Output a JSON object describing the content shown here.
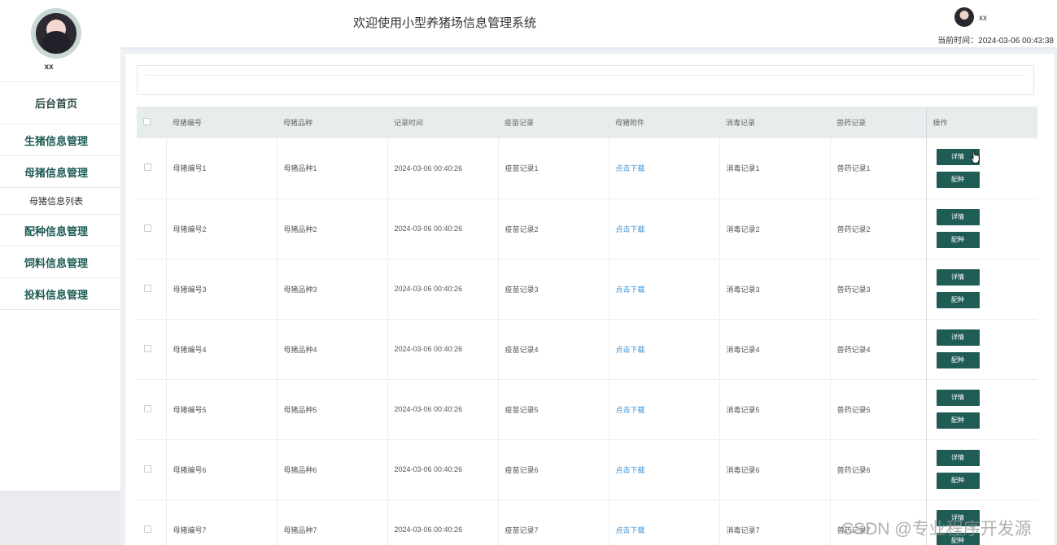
{
  "sidebar": {
    "username": "xx",
    "items": [
      {
        "label": "后台首页"
      },
      {
        "label": "生猪信息管理"
      },
      {
        "label": "母猪信息管理"
      },
      {
        "label": "母猪信息列表"
      },
      {
        "label": "配种信息管理"
      },
      {
        "label": "饲料信息管理"
      },
      {
        "label": "投料信息管理"
      }
    ]
  },
  "header": {
    "title": "欢迎使用小型养猪场信息管理系统",
    "username": "xx",
    "time": "当前时间：2024-03-06 00:43:38"
  },
  "table": {
    "headers": [
      "母猪编号",
      "母猪品种",
      "记录时间",
      "疫苗记录",
      "母猪附件",
      "消毒记录",
      "兽药记录",
      "操作"
    ],
    "rows": [
      {
        "no": "母猪编号1",
        "breed": "母猪品种1",
        "time": "2024-03-06 00:40:26",
        "vaccine": "疫苗记录1",
        "attach": "点击下载",
        "disinfect": "消毒记录1",
        "drug": "兽药记录1"
      },
      {
        "no": "母猪编号2",
        "breed": "母猪品种2",
        "time": "2024-03-06 00:40:26",
        "vaccine": "疫苗记录2",
        "attach": "点击下载",
        "disinfect": "消毒记录2",
        "drug": "兽药记录2"
      },
      {
        "no": "母猪编号3",
        "breed": "母猪品种3",
        "time": "2024-03-06 00:40:26",
        "vaccine": "疫苗记录3",
        "attach": "点击下载",
        "disinfect": "消毒记录3",
        "drug": "兽药记录3"
      },
      {
        "no": "母猪编号4",
        "breed": "母猪品种4",
        "time": "2024-03-06 00:40:26",
        "vaccine": "疫苗记录4",
        "attach": "点击下载",
        "disinfect": "消毒记录4",
        "drug": "兽药记录4"
      },
      {
        "no": "母猪编号5",
        "breed": "母猪品种5",
        "time": "2024-03-06 00:40:26",
        "vaccine": "疫苗记录5",
        "attach": "点击下载",
        "disinfect": "消毒记录5",
        "drug": "兽药记录5"
      },
      {
        "no": "母猪编号6",
        "breed": "母猪品种6",
        "time": "2024-03-06 00:40:26",
        "vaccine": "疫苗记录6",
        "attach": "点击下载",
        "disinfect": "消毒记录6",
        "drug": "兽药记录6"
      },
      {
        "no": "母猪编号7",
        "breed": "母猪品种7",
        "time": "2024-03-06 00:40:26",
        "vaccine": "疫苗记录7",
        "attach": "点击下载",
        "disinfect": "消毒记录7",
        "drug": "兽药记录7"
      }
    ],
    "detail_label": "详情",
    "breed_label": "配种"
  },
  "watermark": "CSDN @专业程序开发源",
  "colors": {
    "accent": "#1f5c55",
    "link": "#3a8fd1",
    "table_header": "#e6edec"
  }
}
